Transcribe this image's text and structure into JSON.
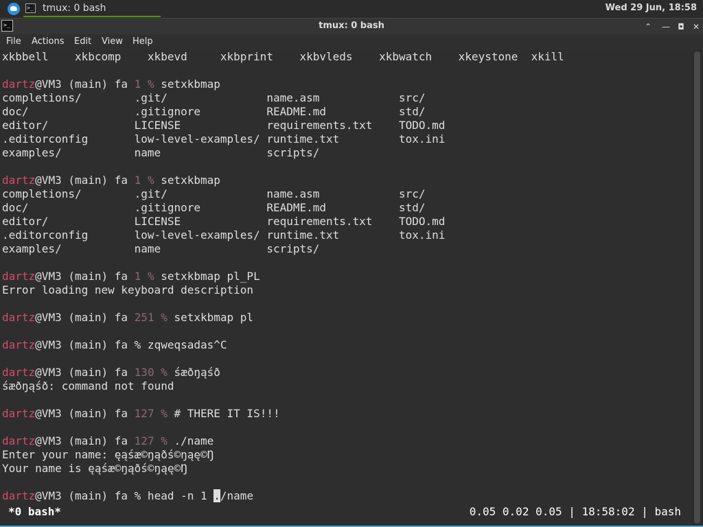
{
  "panel": {
    "task_label": "tmux: 0 bash",
    "task_icon": ">_",
    "clock": "Wed 29 Jun, 18:58"
  },
  "window": {
    "title": "tmux: 0 bash",
    "icon": ">_",
    "btn_up": "⌃",
    "btn_min": "—",
    "btn_max": "◘",
    "btn_close": "✕"
  },
  "menubar": {
    "file": "File",
    "actions": "Actions",
    "edit": "Edit",
    "view": "View",
    "help": "Help"
  },
  "terminal": {
    "lines": [
      {
        "segs": [
          {
            "t": "xkbbell    xkbcomp    xkbevd     xkbprint    xkbvleds    xkbwatch    xkeystone  xkill",
            "c": ""
          }
        ]
      },
      {
        "segs": []
      },
      {
        "segs": [
          {
            "t": "dartz",
            "c": "u"
          },
          {
            "t": "@VM3 (main) fa ",
            "c": ""
          },
          {
            "t": "1 % ",
            "c": "c"
          },
          {
            "t": "setxkbmap",
            "c": ""
          }
        ]
      },
      {
        "segs": [
          {
            "t": "completions/        .git/               name.asm            src/",
            "c": ""
          }
        ]
      },
      {
        "segs": [
          {
            "t": "doc/                .gitignore          README.md           std/",
            "c": ""
          }
        ]
      },
      {
        "segs": [
          {
            "t": "editor/             LICENSE             requirements.txt    TODO.md",
            "c": ""
          }
        ]
      },
      {
        "segs": [
          {
            "t": ".editorconfig       low-level-examples/ runtime.txt         tox.ini",
            "c": ""
          }
        ]
      },
      {
        "segs": [
          {
            "t": "examples/           name                scripts/",
            "c": ""
          }
        ]
      },
      {
        "segs": []
      },
      {
        "segs": [
          {
            "t": "dartz",
            "c": "u"
          },
          {
            "t": "@VM3 (main) fa ",
            "c": ""
          },
          {
            "t": "1 % ",
            "c": "c"
          },
          {
            "t": "setxkbmap",
            "c": ""
          }
        ]
      },
      {
        "segs": [
          {
            "t": "completions/        .git/               name.asm            src/",
            "c": ""
          }
        ]
      },
      {
        "segs": [
          {
            "t": "doc/                .gitignore          README.md           std/",
            "c": ""
          }
        ]
      },
      {
        "segs": [
          {
            "t": "editor/             LICENSE             requirements.txt    TODO.md",
            "c": ""
          }
        ]
      },
      {
        "segs": [
          {
            "t": ".editorconfig       low-level-examples/ runtime.txt         tox.ini",
            "c": ""
          }
        ]
      },
      {
        "segs": [
          {
            "t": "examples/           name                scripts/",
            "c": ""
          }
        ]
      },
      {
        "segs": []
      },
      {
        "segs": [
          {
            "t": "dartz",
            "c": "u"
          },
          {
            "t": "@VM3 (main) fa ",
            "c": ""
          },
          {
            "t": "1 % ",
            "c": "c"
          },
          {
            "t": "setxkbmap pl_PL",
            "c": ""
          }
        ]
      },
      {
        "segs": [
          {
            "t": "Error loading new keyboard description",
            "c": ""
          }
        ]
      },
      {
        "segs": []
      },
      {
        "segs": [
          {
            "t": "dartz",
            "c": "u"
          },
          {
            "t": "@VM3 (main) fa ",
            "c": ""
          },
          {
            "t": "251 % ",
            "c": "c"
          },
          {
            "t": "setxkbmap pl",
            "c": ""
          }
        ]
      },
      {
        "segs": []
      },
      {
        "segs": [
          {
            "t": "dartz",
            "c": "u"
          },
          {
            "t": "@VM3 (main) fa % zqweqsadas^C",
            "c": ""
          }
        ]
      },
      {
        "segs": []
      },
      {
        "segs": [
          {
            "t": "dartz",
            "c": "u"
          },
          {
            "t": "@VM3 (main) fa ",
            "c": ""
          },
          {
            "t": "130 % ",
            "c": "c"
          },
          {
            "t": "śæðŋąśð",
            "c": ""
          }
        ]
      },
      {
        "segs": [
          {
            "t": "śæðŋąśð: command not found",
            "c": ""
          }
        ]
      },
      {
        "segs": []
      },
      {
        "segs": [
          {
            "t": "dartz",
            "c": "u"
          },
          {
            "t": "@VM3 (main) fa ",
            "c": ""
          },
          {
            "t": "127 % ",
            "c": "c"
          },
          {
            "t": "# THERE IT IS!!!",
            "c": ""
          }
        ]
      },
      {
        "segs": []
      },
      {
        "segs": [
          {
            "t": "dartz",
            "c": "u"
          },
          {
            "t": "@VM3 (main) fa ",
            "c": ""
          },
          {
            "t": "127 % ",
            "c": "c"
          },
          {
            "t": "./name",
            "c": ""
          }
        ]
      },
      {
        "segs": [
          {
            "t": "Enter your name: ęąśæ©ŋąðś©ŋąę©Ŋ",
            "c": ""
          }
        ]
      },
      {
        "segs": [
          {
            "t": "Your name is ęąśæ©ŋąðś©ŋąę©Ŋ",
            "c": ""
          }
        ]
      },
      {
        "segs": []
      },
      {
        "segs": [
          {
            "t": "dartz",
            "c": "u"
          },
          {
            "t": "@VM3 (main) fa % head -n 1 ",
            "c": ""
          },
          {
            "t": ".",
            "c": "cursor"
          },
          {
            "t": "/name",
            "c": ""
          }
        ]
      }
    ]
  },
  "status": {
    "left": "*0 bash*",
    "right": "0.05 0.02 0.05 | 18:58:02 | bash"
  }
}
